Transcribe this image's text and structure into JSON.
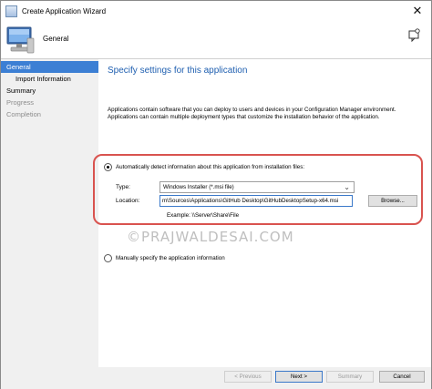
{
  "window": {
    "title": "Create Application Wizard",
    "close_glyph": "✕"
  },
  "header": {
    "page_name": "General"
  },
  "nav": {
    "items": [
      {
        "label": "General"
      },
      {
        "label": "Import Information"
      },
      {
        "label": "Summary"
      },
      {
        "label": "Progress"
      },
      {
        "label": "Completion"
      }
    ]
  },
  "main": {
    "heading": "Specify settings for this application",
    "intro": "Applications contain software that you can deploy to users and devices in your Configuration Manager environment. Applications can contain multiple deployment types that customize the installation behavior of the application.",
    "auto_detect": {
      "label": "Automatically detect information about this application from installation files:",
      "type_label": "Type:",
      "type_value": "Windows Installer (*.msi file)",
      "location_label": "Location:",
      "location_value": "m\\Sources\\Applications\\GitHub Desktop\\GitHubDesktopSetup-x64.msi",
      "browse_label": "Browse...",
      "example": "Example:  \\\\Server\\Share\\File"
    },
    "manual": {
      "label": "Manually specify the application information"
    },
    "watermark": "©PRAJWALDESAI.COM"
  },
  "footer": {
    "previous_label": "< Previous",
    "next_label": "Next >",
    "summary_label": "Summary",
    "cancel_label": "Cancel"
  },
  "colors": {
    "accent": "#3c7fd4",
    "heading": "#1f5fb0",
    "highlight": "#d9534f"
  }
}
